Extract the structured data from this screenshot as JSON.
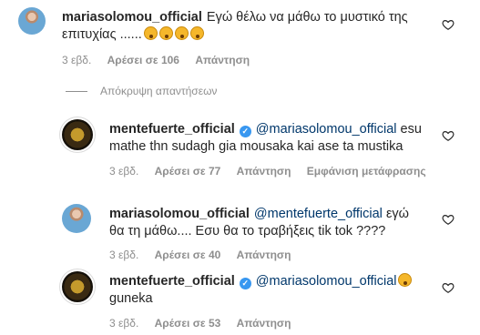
{
  "comments": [
    {
      "username": "mariasolomou_official",
      "body": "Εγώ θέλω να μάθω το μυστικό της επιτυχίας ......",
      "time": "3 εβδ.",
      "likes": "Αρέσει σε 106",
      "reply": "Απάντηση"
    },
    {
      "username": "mentefuerte_official",
      "mention": "@mariasolomou_official",
      "body": "esu mathe thn sudagh gia mousaka kai ase ta mustika",
      "time": "3 εβδ.",
      "likes": "Αρέσει σε 77",
      "reply": "Απάντηση",
      "translate": "Εμφάνιση μετάφρασης"
    },
    {
      "username": "mariasolomou_official",
      "mention": "@mentefuerte_official",
      "body": "εγώ θα τη μάθω.... Εσυ θα το τραβήξεις tik tok ????",
      "time": "3 εβδ.",
      "likes": "Αρέσει σε 40",
      "reply": "Απάντηση"
    },
    {
      "username": "mentefuerte_official",
      "mention": "@mariasolomou_official",
      "body": "guneka",
      "time": "3 εβδ.",
      "likes": "Αρέσει σε 53",
      "reply": "Απάντηση"
    }
  ],
  "hide_replies_label": "Απόκρυψη απαντήσεων",
  "colors": {
    "mention": "#00376b",
    "verified": "#3897f0",
    "meta": "#8e8e8e"
  },
  "icons": {
    "like": "heart-icon",
    "verified": "verified-badge-icon",
    "emoji": "astonished-face-emoji"
  }
}
